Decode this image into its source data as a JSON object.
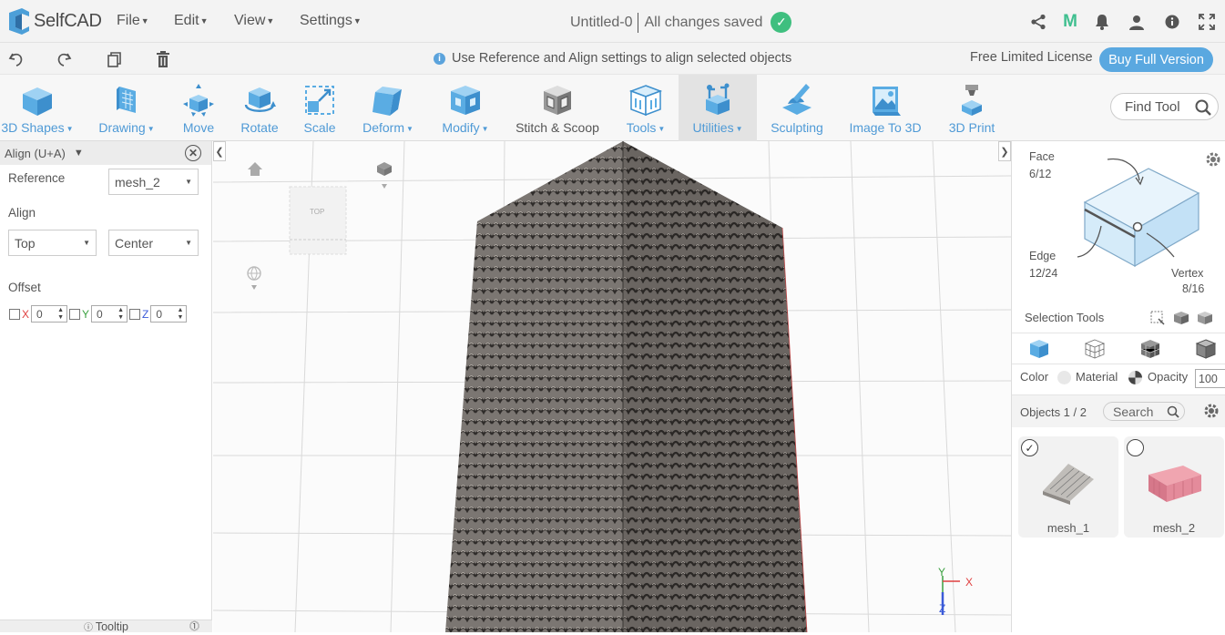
{
  "app": {
    "logo_text": "SelfCAD",
    "menus": [
      "File",
      "Edit",
      "View",
      "Settings"
    ],
    "doc_name": "Untitled-0",
    "save_status": "All changes saved"
  },
  "bar2": {
    "hint": "Use Reference and Align settings to align selected objects",
    "license": "Free Limited License",
    "buy_label": "Buy Full Version"
  },
  "toolbar": {
    "tools": [
      {
        "label": "3D Shapes",
        "dropdown": true
      },
      {
        "label": "Drawing",
        "dropdown": true
      },
      {
        "label": "Move",
        "dropdown": false
      },
      {
        "label": "Rotate",
        "dropdown": false
      },
      {
        "label": "Scale",
        "dropdown": false
      },
      {
        "label": "Deform",
        "dropdown": true
      },
      {
        "label": "Modify",
        "dropdown": true
      },
      {
        "label": "Stitch & Scoop",
        "dropdown": false
      },
      {
        "label": "Tools",
        "dropdown": true
      },
      {
        "label": "Utilities",
        "dropdown": true,
        "active": true
      },
      {
        "label": "Sculpting",
        "dropdown": false
      },
      {
        "label": "Image To 3D",
        "dropdown": false
      },
      {
        "label": "3D Print",
        "dropdown": false
      }
    ],
    "find_tool": "Find Tool"
  },
  "align_panel": {
    "title": "Align (U+A)",
    "reference_label": "Reference",
    "reference_value": "mesh_2",
    "align_label": "Align",
    "align_value_1": "Top",
    "align_value_2": "Center",
    "offset_label": "Offset",
    "offset": {
      "x_label": "X",
      "x": "0",
      "y_label": "Y",
      "y": "0",
      "z_label": "Z",
      "z": "0"
    },
    "tooltip_label": "Tooltip"
  },
  "viewport": {
    "view_cube_label": "TOP",
    "axis_x": "X",
    "axis_y": "Y",
    "axis_z": "Z"
  },
  "right_panel": {
    "face_label": "Face",
    "face_count": "6/12",
    "edge_label": "Edge",
    "edge_count": "12/24",
    "vertex_label": "Vertex",
    "vertex_count": "8/16",
    "selection_tools": "Selection Tools",
    "color_label": "Color",
    "material_label": "Material",
    "opacity_label": "Opacity",
    "opacity_value": "100",
    "objects_label": "Objects 1 / 2",
    "search_placeholder": "Search",
    "objects": [
      {
        "name": "mesh_1",
        "selected": true,
        "color": "#bdbdbd"
      },
      {
        "name": "mesh_2",
        "selected": false,
        "color": "#e58a97"
      }
    ]
  },
  "colors": {
    "accent": "#4f9ad6",
    "buy_button": "#5aa8e0",
    "saved_check": "#3fbf7f",
    "tile_roof": "#6e6a66"
  }
}
